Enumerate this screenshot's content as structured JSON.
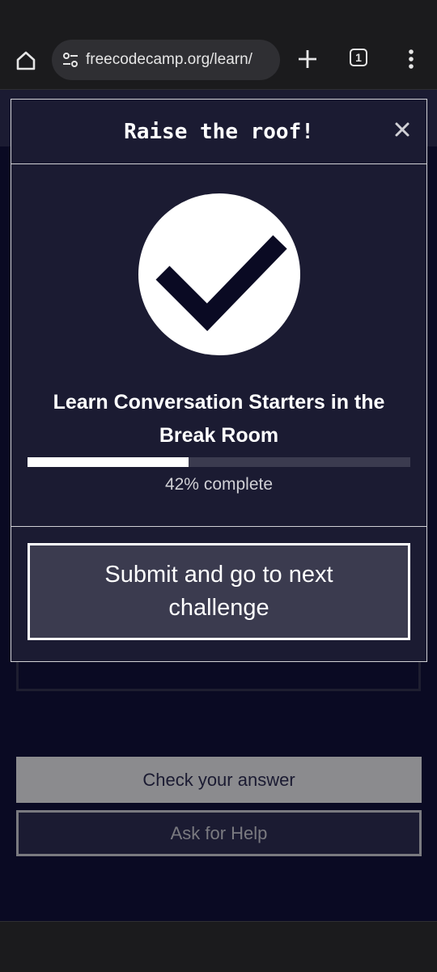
{
  "browser": {
    "url": "freecodecamp.org/learn/",
    "tab_count": "1"
  },
  "modal": {
    "title": "Raise the roof!",
    "block_title": "Learn Conversation Starters in the Break Room",
    "progress_percent": 42,
    "progress_text": "42% complete",
    "submit_label": "Submit and go to next challenge"
  },
  "page": {
    "check_label": "Check your answer",
    "help_label": "Ask for Help"
  },
  "colors": {
    "modal_bg": "#1b1b32",
    "page_bg": "#0a0a23",
    "button_bg": "#3b3b4f",
    "check_button_bg": "#8b8b8e"
  },
  "icons": {
    "home": "home-icon",
    "site_info": "site-settings-icon",
    "new_tab": "plus-icon",
    "tabs": "tab-switcher-icon",
    "menu": "kebab-menu-icon",
    "close": "close-icon",
    "success": "checkmark-icon"
  }
}
